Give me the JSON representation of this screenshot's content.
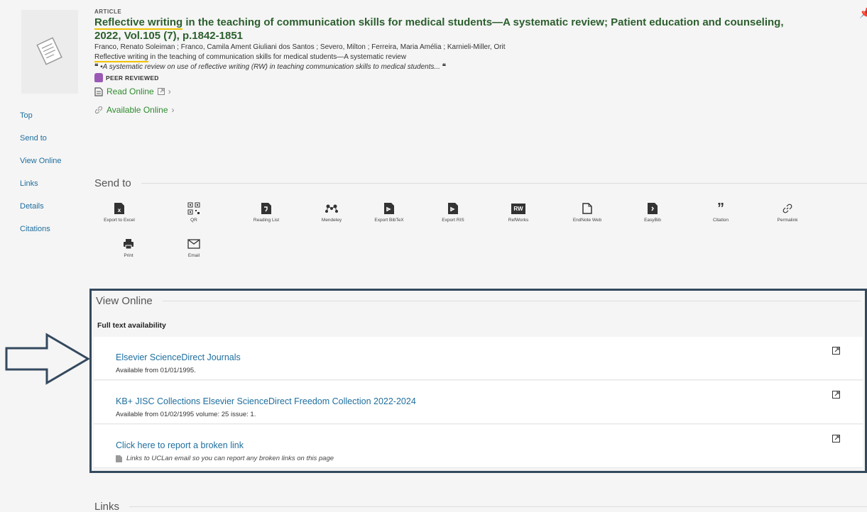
{
  "record": {
    "type": "ARTICLE",
    "title_highlight": "Reflective writing",
    "title_rest": " in the teaching of communication skills for medical students—A systematic review; Patient education and counseling,",
    "title_line2": "2022, Vol.105 (7), p.1842-1851",
    "authors": "Franco, Renato Soleiman ; Franco, Camila Ament Giuliani dos Santos ; Severo, Milton ; Ferreira, Maria Amélia ; Karnieli-Miller, Orit",
    "subtitle_highlight": "Reflective writing",
    "subtitle_rest": " in the teaching of communication skills for medical students—A systematic review",
    "snippet": "•A systematic review on use of reflective writing (RW) in teaching communication skills to medical students...",
    "quote_mark": "❝",
    "peer_reviewed": "PEER REVIEWED",
    "read_online": "Read Online",
    "available_online": "Available Online"
  },
  "side_nav": [
    "Top",
    "Send to",
    "View Online",
    "Links",
    "Details",
    "Citations"
  ],
  "send_to": {
    "heading": "Send to",
    "items": [
      {
        "label": "Export to Excel",
        "icon": "excel-icon"
      },
      {
        "label": "QR",
        "icon": "qr-icon"
      },
      {
        "label": "Reading List",
        "icon": "reading-list-icon"
      },
      {
        "label": "Mendeley",
        "icon": "mendeley-icon"
      },
      {
        "label": "Export BibTeX",
        "icon": "bibtex-icon"
      },
      {
        "label": "Export RIS",
        "icon": "ris-icon"
      },
      {
        "label": "RefWorks",
        "icon": "refworks-icon"
      },
      {
        "label": "EndNote Web",
        "icon": "endnote-icon"
      },
      {
        "label": "EasyBib",
        "icon": "easybib-icon"
      },
      {
        "label": "Citation",
        "icon": "citation-icon"
      },
      {
        "label": "Permalink",
        "icon": "permalink-icon"
      },
      {
        "label": "Print",
        "icon": "print-icon"
      },
      {
        "label": "Email",
        "icon": "email-icon"
      }
    ],
    "refworks_badge": "RW"
  },
  "view_online": {
    "heading": "View Online",
    "full_text_label": "Full text availability",
    "services": [
      {
        "name": "Elsevier ScienceDirect Journals",
        "note": "Available from 01/01/1995."
      },
      {
        "name": "KB+ JISC Collections Elsevier ScienceDirect Freedom Collection 2022-2024",
        "note": "Available from 01/02/1995 volume: 25 issue: 1."
      },
      {
        "name": "Click here to report a broken link",
        "note": "Links to UCLan email so you can report any broken links on this page"
      }
    ]
  },
  "links": {
    "heading": "Links"
  },
  "colors": {
    "link": "#1e6e9e",
    "title": "#2c5f2e",
    "highlight": "#f2c200",
    "box_border": "#34495e"
  }
}
